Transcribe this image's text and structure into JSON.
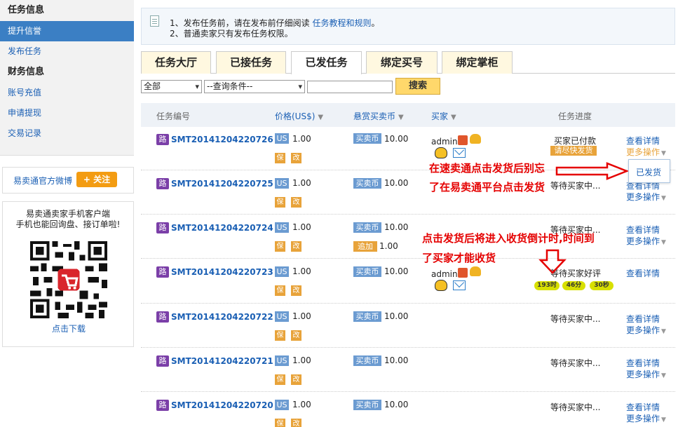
{
  "sidebar": {
    "section1": "任务信息",
    "items1": [
      "提升信誉",
      "发布任务"
    ],
    "section2": "财务信息",
    "items2": [
      "账号充值",
      "申请提现",
      "交易记录"
    ],
    "weibo_label": "易卖通官方微博",
    "follow_label": "+ 关注",
    "mobile_line1": "易卖通卖家手机客户端",
    "mobile_line2": "手机也能回询盘、接订单啦!",
    "download_label": "点击下载"
  },
  "notice": {
    "line1_prefix": "1、发布任务前，请在发布前仔细阅读",
    "line1_link": "任务教程和规则",
    "line1_suffix": "。",
    "line2": "2、普通卖家只有发布任务权限。"
  },
  "tabs": [
    "任务大厅",
    "已接任务",
    "已发任务",
    "绑定买号",
    "绑定掌柜"
  ],
  "active_tab": "已发任务",
  "search": {
    "status_value": "全部",
    "condition_value": "--查询条件--",
    "button_label": "搜索"
  },
  "table": {
    "headers": {
      "task_id": "任务编号",
      "price": "价格(US$)",
      "coin": "悬赏买卖币",
      "buyer": "买家",
      "progress": "任务进度"
    },
    "rows": [
      {
        "tag": "路",
        "id": "SMT20141204220726",
        "currency": "US",
        "price": "1.00",
        "tag_bao": "保",
        "tag_gai": "改",
        "coin_tag": "买卖币",
        "coin": "10.00",
        "buyer": "admin",
        "status": "买家已付款",
        "urge": "请尽快发货",
        "view": "查看详情",
        "more": "更多操作"
      },
      {
        "tag": "路",
        "id": "SMT20141204220725",
        "currency": "US",
        "price": "1.00",
        "tag_bao": "保",
        "tag_gai": "改",
        "coin_tag": "买卖币",
        "coin": "10.00",
        "status": "等待买家中...",
        "view": "查看详情",
        "more": "更多操作"
      },
      {
        "tag": "路",
        "id": "SMT20141204220724",
        "currency": "US",
        "price": "1.00",
        "tag_bao": "保",
        "tag_gai": "改",
        "coin_tag": "买卖币",
        "coin": "10.00",
        "add_tag": "追加",
        "add_value": "1.00",
        "status": "等待买家中...",
        "view": "查看详情",
        "more": "更多操作"
      },
      {
        "tag": "路",
        "id": "SMT20141204220723",
        "currency": "US",
        "price": "1.00",
        "tag_bao": "保",
        "tag_gai": "改",
        "coin_tag": "买卖币",
        "coin": "10.00",
        "buyer": "admin",
        "status": "等待买家好评",
        "timers": [
          "193时",
          "46分",
          "30秒"
        ],
        "view": "查看详情"
      },
      {
        "tag": "路",
        "id": "SMT20141204220722",
        "currency": "US",
        "price": "1.00",
        "tag_bao": "保",
        "tag_gai": "改",
        "coin_tag": "买卖币",
        "coin": "10.00",
        "status": "等待买家中...",
        "view": "查看详情",
        "more": "更多操作"
      },
      {
        "tag": "路",
        "id": "SMT20141204220721",
        "currency": "US",
        "price": "1.00",
        "tag_bao": "保",
        "tag_gai": "改",
        "coin_tag": "买卖币",
        "coin": "10.00",
        "status": "等待买家中...",
        "view": "查看详情",
        "more": "更多操作"
      },
      {
        "tag": "路",
        "id": "SMT20141204220720",
        "currency": "US",
        "price": "1.00",
        "tag_bao": "保",
        "tag_gai": "改",
        "coin_tag": "买卖币",
        "coin": "10.00",
        "status": "等待买家中...",
        "view": "查看详情",
        "more": "更多操作"
      }
    ]
  },
  "dropdown": {
    "item": "已发货"
  },
  "annotations": {
    "a1_line1": "在速卖通点击发货后别忘",
    "a1_line2": "了在易卖通平台点击发货",
    "a2_line1": "点击发货后将进入收货倒计时,时间到",
    "a2_line2": "了买家才能收货"
  },
  "colors": {
    "accent": "#3b7fc4",
    "link": "#1a5fb4",
    "annotation": "#e50000",
    "tag_orange": "#e8a33a"
  }
}
